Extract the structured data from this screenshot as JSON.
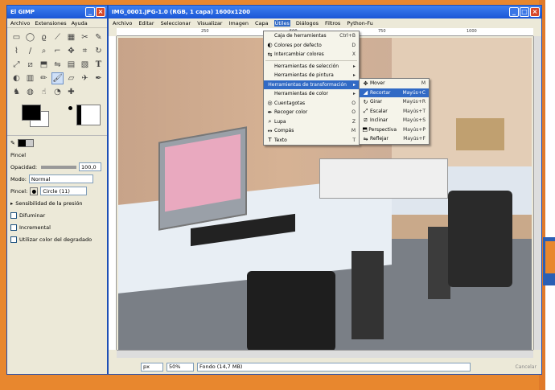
{
  "toolbox": {
    "title": "El GIMP",
    "menu": [
      "Archivo",
      "Extensiones",
      "Ayuda"
    ],
    "tool_options_title": "Pincel",
    "opacity_label": "Opacidad:",
    "opacity_value": "100,0",
    "mode_label": "Modo:",
    "mode_value": "Normal",
    "brush_label": "Pincel:",
    "brush_value": "Circle (11)",
    "pressure_label": "Sensibilidad de la presión",
    "fade_label": "Difuminar",
    "incremental_label": "Incremental",
    "gradient_label": "Utilizar color del degradado"
  },
  "image_window": {
    "title": "IMG_0001.JPG-1.0 (RGB, 1 capa) 1600x1200",
    "menu": [
      "Archivo",
      "Editar",
      "Seleccionar",
      "Visualizar",
      "Imagen",
      "Capa",
      "Útiles",
      "Diálogos",
      "Filtros",
      "Python-Fu"
    ],
    "active_menu_index": 6,
    "ruler_ticks": [
      "250",
      "500",
      "750",
      "1000"
    ],
    "unit": "px",
    "zoom": "50%",
    "status_text": "Fondo (14,7 MB)",
    "cancel_label": "Cancelar"
  },
  "utiles_menu": {
    "items": [
      {
        "icon": "",
        "label": "Caja de herramientas",
        "shortcut": "Ctrl+B"
      },
      {
        "icon": "◐",
        "label": "Colores por defecto",
        "shortcut": "D"
      },
      {
        "icon": "⇆",
        "label": "Intercambiar colores",
        "shortcut": "X"
      },
      {
        "divider": true
      },
      {
        "icon": "",
        "label": "Herramientas de selección",
        "shortcut": "▸"
      },
      {
        "icon": "",
        "label": "Herramientas de pintura",
        "shortcut": "▸"
      },
      {
        "icon": "",
        "label": "Herramientas de transformación",
        "shortcut": "▸",
        "highlighted": true
      },
      {
        "icon": "",
        "label": "Herramientas de color",
        "shortcut": "▸"
      },
      {
        "icon": "◎",
        "label": "Cuentagotas",
        "shortcut": "O"
      },
      {
        "icon": "✒",
        "label": "Recoger color",
        "shortcut": "O"
      },
      {
        "icon": "⌕",
        "label": "Lupa",
        "shortcut": "Z"
      },
      {
        "icon": "↔",
        "label": "Compás",
        "shortcut": "M"
      },
      {
        "icon": "T",
        "label": "Texto",
        "shortcut": "T"
      }
    ]
  },
  "transform_submenu": {
    "items": [
      {
        "icon": "✥",
        "label": "Mover",
        "shortcut": "M"
      },
      {
        "icon": "◢",
        "label": "Recortar",
        "shortcut": "Mayús+C",
        "highlighted": true
      },
      {
        "icon": "↻",
        "label": "Girar",
        "shortcut": "Mayús+R"
      },
      {
        "icon": "⤢",
        "label": "Escalar",
        "shortcut": "Mayús+T"
      },
      {
        "icon": "⧄",
        "label": "Inclinar",
        "shortcut": "Mayús+S"
      },
      {
        "icon": "⬒",
        "label": "Perspectiva",
        "shortcut": "Mayús+P"
      },
      {
        "icon": "⇋",
        "label": "Reflejar",
        "shortcut": "Mayús+F"
      }
    ]
  }
}
